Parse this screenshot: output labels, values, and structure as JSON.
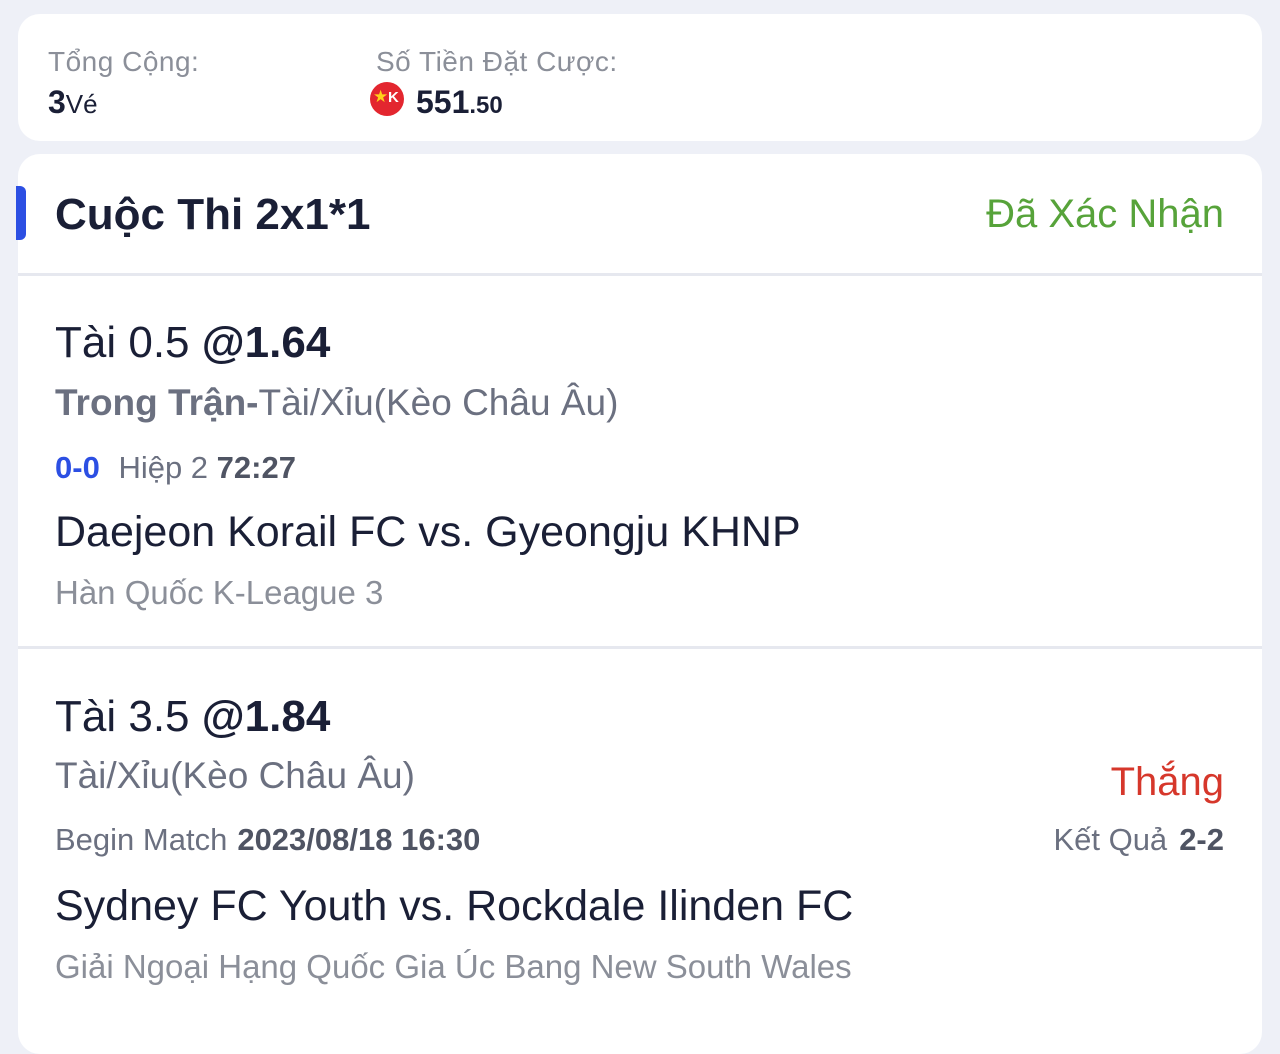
{
  "summary": {
    "total_label": "Tổng Cộng:",
    "total_count": "3",
    "total_unit": "Vé",
    "stake_label": "Số Tiền Đặt Cược:",
    "coin_icon": "vn-k-coin-icon",
    "stake_int": "551",
    "stake_dec": ".50"
  },
  "bet": {
    "title": "Cuộc Thi 2x1*1",
    "status": "Đã Xác Nhận",
    "status_color": "#57a33a",
    "accent_color": "#2c4fe3",
    "selections": [
      {
        "pick": "Tài 0.5",
        "odds": "@1.64",
        "phase": "Trong Trận-",
        "market": "Tài/Xỉu(Kèo Châu Âu)",
        "score": "0-0",
        "period": "Hiệp 2",
        "clock": "72:27",
        "teams": "Daejeon Korail FC vs. Gyeongju KHNP",
        "league": "Hàn Quốc K-League 3"
      },
      {
        "pick": "Tài 3.5",
        "odds": "@1.84",
        "market": "Tài/Xỉu(Kèo Châu Âu)",
        "result": "Thắng",
        "result_color": "#d6372b",
        "begin_label": "Begin Match",
        "begin_datetime": "2023/08/18 16:30",
        "final_label": "Kết Quả",
        "final_score": "2-2",
        "teams": "Sydney FC Youth vs. Rockdale Ilinden FC",
        "league": "Giải Ngoại Hạng Quốc Gia Úc Bang New South Wales"
      }
    ]
  }
}
